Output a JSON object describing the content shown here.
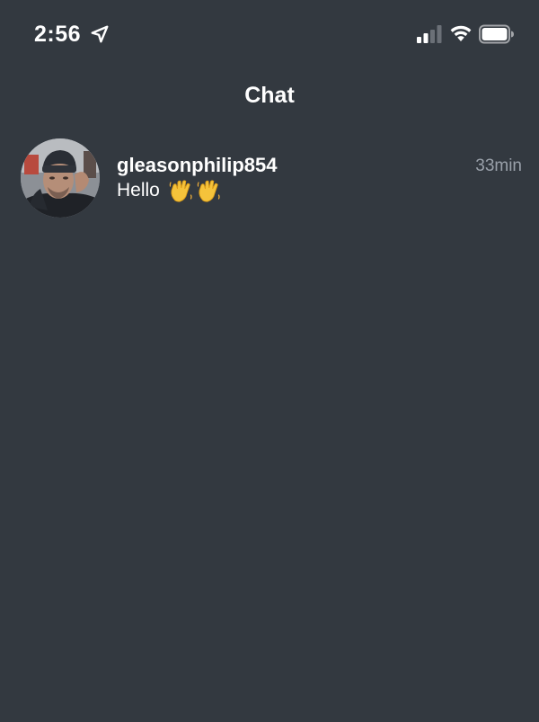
{
  "status_bar": {
    "time": "2:56",
    "icons": [
      "location-arrow-icon",
      "cellular-signal-icon",
      "wifi-icon",
      "battery-icon"
    ]
  },
  "header": {
    "title": "Chat"
  },
  "chats": [
    {
      "username": "gleasonphilip854",
      "message_text": "Hello",
      "message_emoji": [
        "waving-hand-icon",
        "waving-hand-icon"
      ],
      "time": "33min"
    }
  ],
  "colors": {
    "background": "#333940",
    "text_primary": "#ffffff",
    "text_secondary": "#9aa1aa"
  }
}
